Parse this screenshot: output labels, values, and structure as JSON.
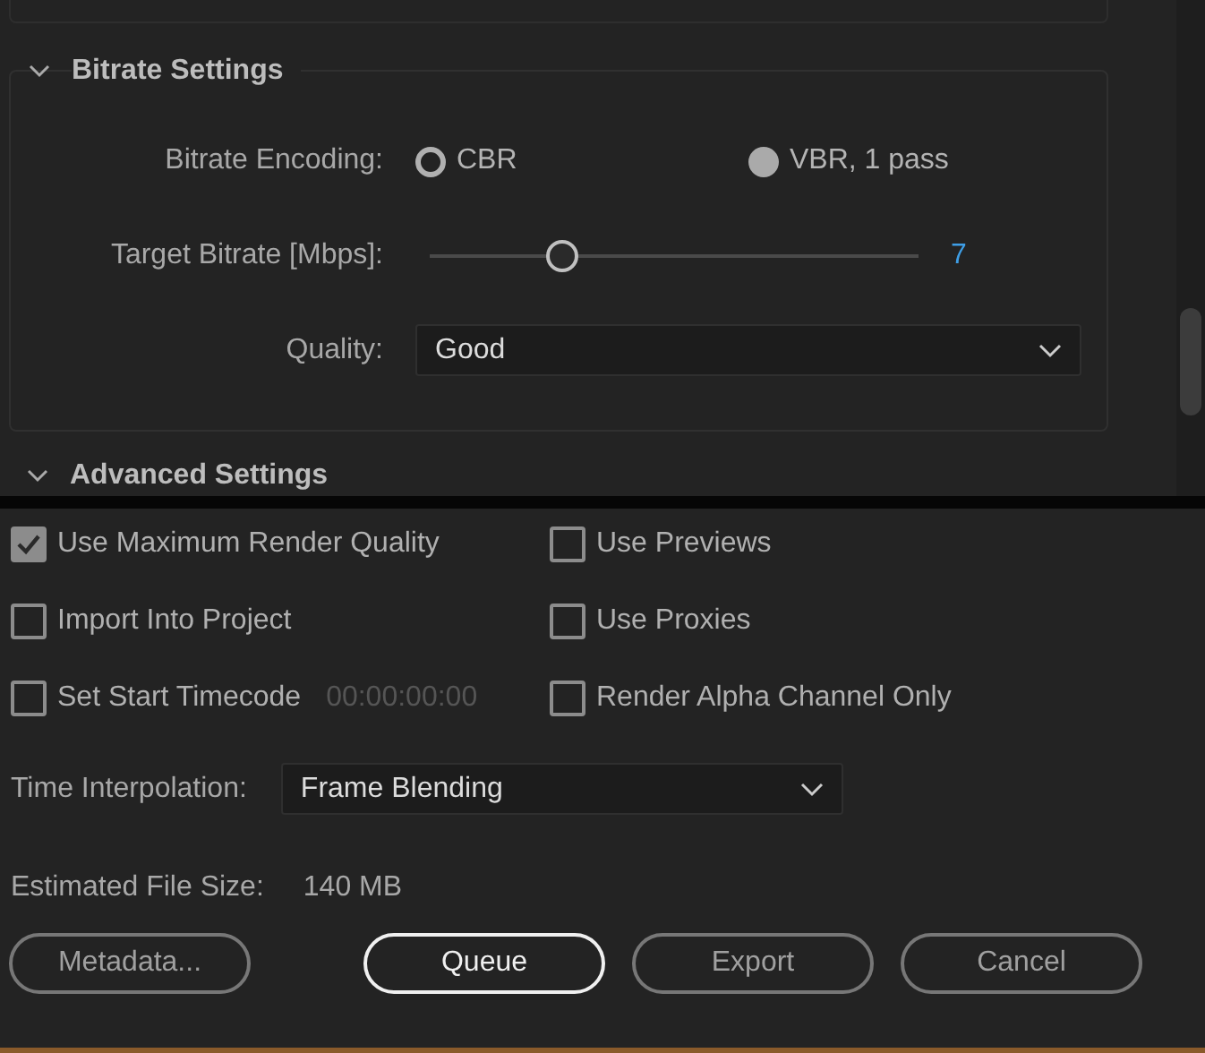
{
  "bitrate_settings": {
    "title": "Bitrate Settings",
    "expanded": true,
    "encoding": {
      "label": "Bitrate Encoding:",
      "options": [
        {
          "label": "CBR",
          "selected": false
        },
        {
          "label": "VBR, 1 pass",
          "selected": true
        }
      ]
    },
    "target_bitrate": {
      "label": "Target Bitrate [Mbps]:",
      "level": 0.27,
      "reading": "7"
    },
    "quality": {
      "label": "Quality:",
      "value": "Good"
    }
  },
  "advanced_settings": {
    "title": "Advanced Settings",
    "expanded": true
  },
  "options": [
    {
      "label": "Use Maximum Render Quality",
      "checked": true
    },
    {
      "label": "Use Previews",
      "checked": false
    },
    {
      "label": "Import Into Project",
      "checked": false
    },
    {
      "label": "Use Proxies",
      "checked": false
    },
    {
      "label": "Set Start Timecode",
      "checked": false,
      "timecode": "00:00:00:00"
    },
    {
      "label": "Render Alpha Channel Only",
      "checked": false
    }
  ],
  "time_interpolation": {
    "label": "Time Interpolation:",
    "value": "Frame Blending"
  },
  "estimated_file_size": {
    "label": "Estimated File Size:",
    "value": "140 MB"
  },
  "buttons": [
    {
      "label": "Metadata...",
      "default": false
    },
    {
      "label": "Queue",
      "default": true
    },
    {
      "label": "Export",
      "default": false
    },
    {
      "label": "Cancel",
      "default": false
    }
  ]
}
